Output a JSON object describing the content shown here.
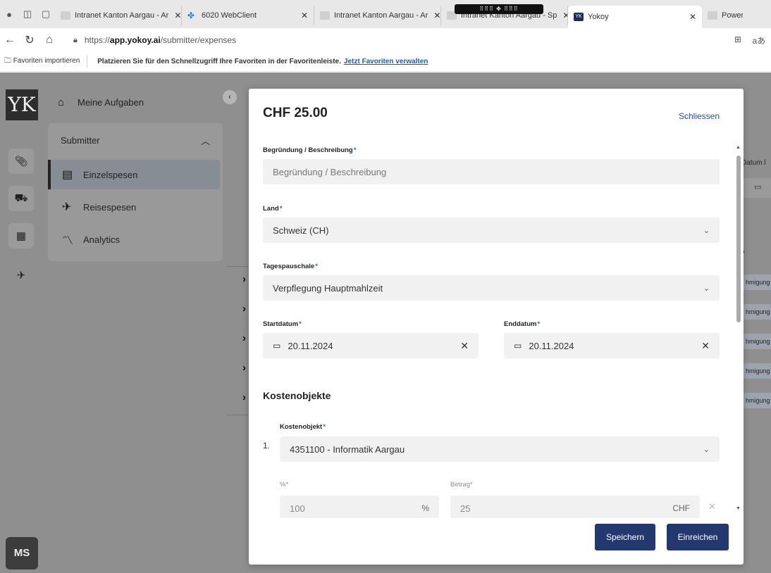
{
  "browser": {
    "tabs": [
      {
        "label": "Intranet Kanton Aargau - Ar"
      },
      {
        "label": "6020 WebClient"
      },
      {
        "label": "Intranet Kanton Aargau - Ar"
      },
      {
        "label": "Intranet Kanton Aargau - Sp"
      },
      {
        "label": "Yokoy"
      },
      {
        "label": "Power"
      }
    ],
    "drag_handle": "⠿⠿⠿ ✥ ⠿⠿⠿",
    "url_prefix": "https://",
    "url_domain": "app.yokoy.ai",
    "url_path": "/submitter/expenses",
    "favbar_import": "Favoriten importieren",
    "favbar_message": "Platzieren Sie für den Schnellzugriff Ihre Favoriten in der Favoritenleiste.",
    "favbar_link": "Jetzt Favoriten verwalten"
  },
  "app": {
    "logo": "YK",
    "avatar_initials": "MS",
    "sidebar": {
      "my_tasks": "Meine Aufgaben",
      "group": "Submitter",
      "items": [
        {
          "label": "Einzelspesen"
        },
        {
          "label": "Reisespesen"
        },
        {
          "label": "Analytics"
        }
      ]
    },
    "background": {
      "datum_header": "Datum l",
      "badges": [
        "hmigung",
        "hmigung",
        "hmigung",
        "hmigung",
        "hmigung"
      ]
    }
  },
  "modal": {
    "amount": "CHF 25.00",
    "close_label": "Schliessen",
    "description": {
      "label": "Begründung / Beschreibung",
      "placeholder": "Begründung / Beschreibung"
    },
    "country": {
      "label": "Land",
      "value": "Schweiz (CH)"
    },
    "daily_allowance": {
      "label": "Tagespauschale",
      "value": "Verpflegung Hauptmahlzeit"
    },
    "start_date": {
      "label": "Startdatum",
      "value": "20.11.2024"
    },
    "end_date": {
      "label": "Enddatum",
      "value": "20.11.2024"
    },
    "cost_objects_title": "Kostenobjekte",
    "cost_object": {
      "index": "1.",
      "label": "Kostenobjekt",
      "value": "4351100 - Informatik Aargau",
      "percent_label": "%",
      "percent_value": "100",
      "percent_unit": "%",
      "amount_label": "Betrag",
      "amount_value": "25",
      "amount_unit": "CHF"
    },
    "save_label": "Speichern",
    "submit_label": "Einreichen"
  },
  "colors": {
    "primary_button": "#23386e",
    "link": "#2d4b8e",
    "required_marker": "#2d69c9"
  }
}
